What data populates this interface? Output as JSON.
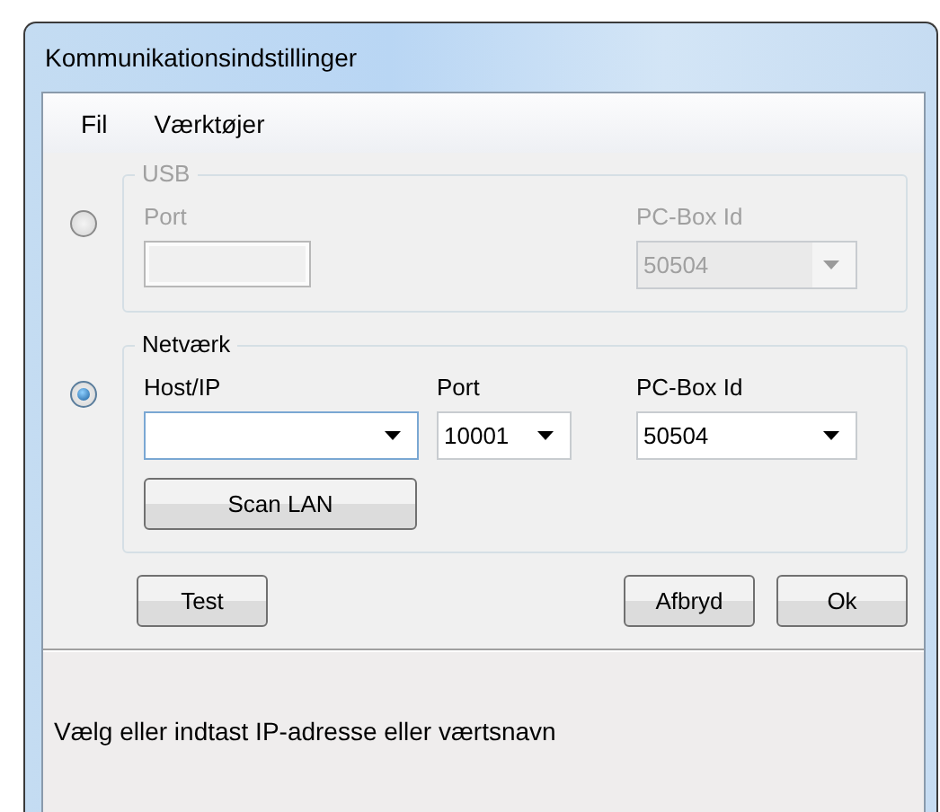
{
  "window": {
    "title": "Kommunikationsindstillinger"
  },
  "menu": [
    "Fil",
    "Værktøjer"
  ],
  "groups": [
    {
      "title": "USB",
      "selected": false,
      "disabled": true,
      "fields": [
        {
          "kind": "textbox",
          "label": "Port"
        },
        {
          "kind": "combo",
          "label": "PC-Box Id",
          "value": "50504"
        }
      ]
    },
    {
      "title": "Netværk",
      "selected": true,
      "disabled": false,
      "fields": [
        {
          "kind": "combo",
          "label": "Host/IP",
          "focused": true
        },
        {
          "kind": "combo",
          "label": "Port",
          "value": "10001"
        },
        {
          "kind": "combo",
          "label": "PC-Box Id",
          "value": "50504"
        }
      ],
      "buttons": [
        "Scan LAN"
      ]
    }
  ],
  "buttons_left": [
    "Test"
  ],
  "buttons_right": [
    "Afbryd",
    "Ok"
  ],
  "status": "Vælg eller indtast IP-adresse eller værtsnavn"
}
